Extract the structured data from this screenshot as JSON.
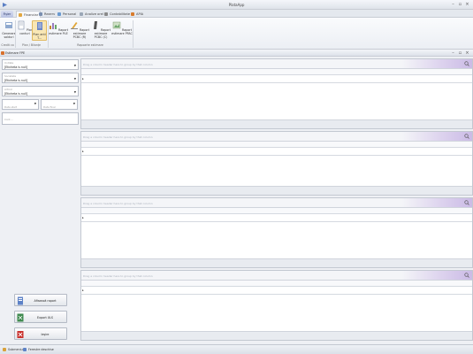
{
  "window": {
    "title": "PlataApp"
  },
  "file_tab": {
    "label": "Fișier"
  },
  "tabs": [
    {
      "label": "Financiar",
      "active": true
    },
    {
      "label": "Rezerv",
      "active": false
    },
    {
      "label": "Personal",
      "active": false
    },
    {
      "label": "Analize orel",
      "active": false
    },
    {
      "label": "Contabilitate",
      "active": false
    },
    {
      "label": "APIA",
      "active": false
    }
  ],
  "ribbon": {
    "buttons": [
      {
        "label": "Generare solduri"
      },
      {
        "label": "Plan conturi"
      },
      {
        "label": "Plan anti T...",
        "selected": true
      },
      {
        "label": "Raport estimare PLE"
      },
      {
        "label": "Raport estimare PCBC (R)"
      },
      {
        "label": "Raport estimare PCBC (C)"
      },
      {
        "label": "Raport estimare PFAC"
      }
    ],
    "groups": [
      {
        "label": "Credit co"
      },
      {
        "label": "Plan / Bilanțe"
      },
      {
        "label": "Rapoarte estimare"
      }
    ]
  },
  "document": {
    "title": "Estimare FPE"
  },
  "filters": {
    "combo1": {
      "label": "Unitate",
      "value": "[Eticheta is null]"
    },
    "combo2": {
      "label": "Societate",
      "value": "[Eticheta is null]"
    },
    "combo3": {
      "label": "Articol",
      "value": "[Eticheta is null]"
    },
    "data_start": "Data start",
    "data_final": "Data final",
    "cont_label": "Cont ..."
  },
  "grids": [
    {
      "group_hint": "Drag a column header here to group by that column"
    },
    {
      "group_hint": "Drag a column header here to group by that column"
    },
    {
      "group_hint": "Drag a column header here to group by that column"
    },
    {
      "group_hint": "Drag a column header here to group by that column"
    }
  ],
  "actions": {
    "show_report": "Afisează raport",
    "export_xls": "Export XLS",
    "exit": "Ieșire"
  },
  "status": {
    "submenu": "Submeniul",
    "open_windows": "Ferestre deschise"
  }
}
